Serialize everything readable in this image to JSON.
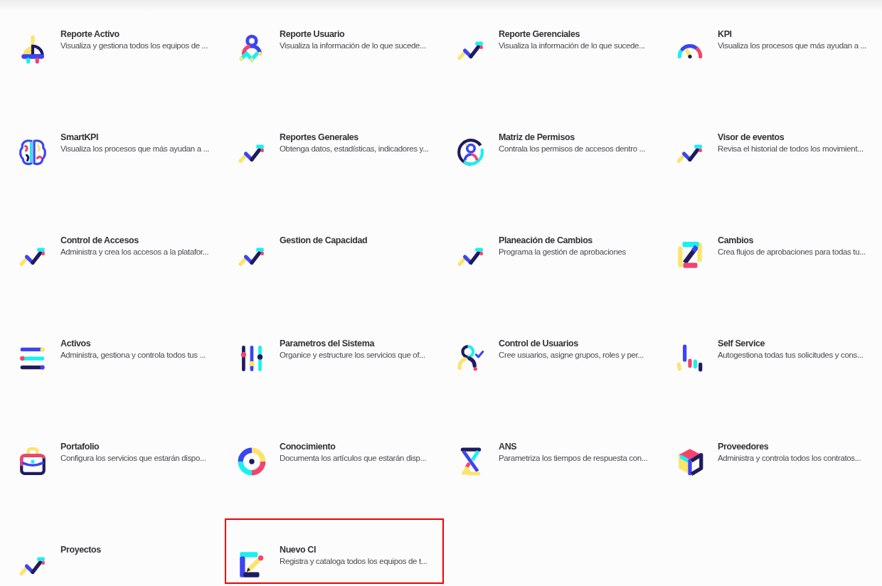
{
  "apps": [
    {
      "kind": "plug",
      "title": "Reporte Activo",
      "description": "Visualiza y gestiona todos los equipos de ...",
      "highlighted": false
    },
    {
      "kind": "person",
      "title": "Reporte Usuario",
      "description": "Visualiza la información de lo que sucede...",
      "highlighted": false
    },
    {
      "kind": "trend",
      "title": "Reporte Gerenciales",
      "description": "Visualiza la información de lo que sucede...",
      "highlighted": false
    },
    {
      "kind": "gauge",
      "title": "KPI",
      "description": "Visualiza los procesos que más ayudan a ...",
      "highlighted": false
    },
    {
      "kind": "brain",
      "title": "SmartKPI",
      "description": "Visualiza los procesos que más ayudan a ...",
      "highlighted": false
    },
    {
      "kind": "trend",
      "title": "Reportes Generales",
      "description": "Obtenga datos, estadísticas, indicadores y...",
      "highlighted": false
    },
    {
      "kind": "usercircle",
      "title": "Matriz de Permisos",
      "description": "Contrala los permisos de accesos dentro ...",
      "highlighted": false
    },
    {
      "kind": "trend",
      "title": "Visor de eventos",
      "description": "Revisa el historial de todos los movimient...",
      "highlighted": false
    },
    {
      "kind": "trend",
      "title": "Control de Accesos",
      "description": "Administra y crea los accesos a la platafor...",
      "highlighted": false
    },
    {
      "kind": "trend",
      "title": "Gestion de Capacidad",
      "highlighted": false
    },
    {
      "kind": "trend",
      "title": "Planeación de Cambios",
      "description": "Programa la gestión de aprobaciones",
      "highlighted": false
    },
    {
      "kind": "zletter",
      "title": "Cambios",
      "description": "Crea flujos de aprobaciones para todas tu...",
      "highlighted": false
    },
    {
      "kind": "bars",
      "title": "Activos",
      "description": "Administra, gestiona y controla todos tus ...",
      "highlighted": false
    },
    {
      "kind": "sliders",
      "title": "Parametros del Sistema",
      "description": "Organice y estructure los servicios que of...",
      "highlighted": false
    },
    {
      "kind": "checkeduser",
      "title": "Control de Usuarios",
      "description": "Cree usuarios, asigne grupos, roles y per...",
      "highlighted": false
    },
    {
      "kind": "signal",
      "title": "Self Service",
      "description": "Autogestiona todas tus solicitudes y cons...",
      "highlighted": false
    },
    {
      "kind": "briefcase",
      "title": "Portafolio",
      "description": "Configura los servicios que estarán dispo...",
      "highlighted": false
    },
    {
      "kind": "ring",
      "title": "Conocimiento",
      "description": "Documenta los artículos que estarán disp...",
      "highlighted": false
    },
    {
      "kind": "hourglass",
      "title": "ANS",
      "description": "Parametriza los tiempos de respuesta con...",
      "highlighted": false
    },
    {
      "kind": "cube",
      "title": "Proveedores",
      "description": "Administra y controla todos los contratos...",
      "highlighted": false
    },
    {
      "kind": "trend",
      "title": "Proyectos",
      "highlighted": false
    },
    {
      "kind": "pencil",
      "title": "Nuevo CI",
      "description": "Registra y cataloga todos los equipos de t...",
      "highlighted": true
    }
  ]
}
